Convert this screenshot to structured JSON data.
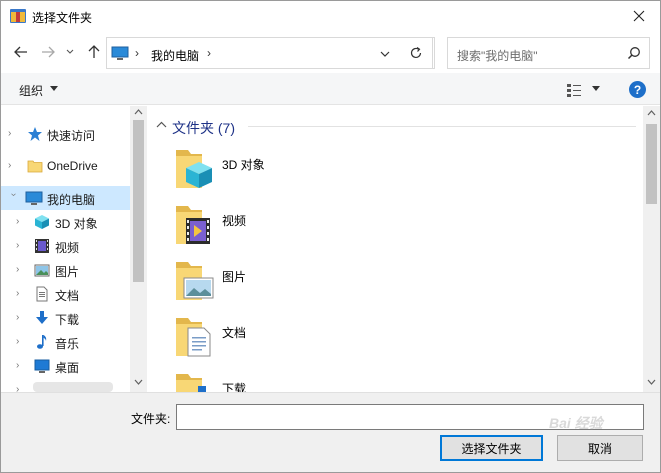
{
  "window": {
    "title": "选择文件夹"
  },
  "nav": {
    "address_text": "我的电脑",
    "search_placeholder": "搜索\"我的电脑\""
  },
  "toolbar": {
    "organize_label": "组织"
  },
  "sidebar": {
    "items": [
      {
        "label": "快速访问",
        "icon": "star-icon"
      },
      {
        "label": "OneDrive",
        "icon": "folder-icon"
      },
      {
        "label": "我的电脑",
        "icon": "computer-icon",
        "selected": true
      },
      {
        "label": "3D 对象",
        "icon": "cube-icon"
      },
      {
        "label": "视频",
        "icon": "film-icon"
      },
      {
        "label": "图片",
        "icon": "picture-icon"
      },
      {
        "label": "文档",
        "icon": "document-icon"
      },
      {
        "label": "下载",
        "icon": "download-icon"
      },
      {
        "label": "音乐",
        "icon": "music-icon"
      },
      {
        "label": "桌面",
        "icon": "desktop-icon"
      }
    ]
  },
  "main": {
    "group_title": "文件夹 (7)",
    "folders": [
      {
        "label": "3D 对象",
        "icon": "cube-folder-icon"
      },
      {
        "label": "视频",
        "icon": "film-folder-icon"
      },
      {
        "label": "图片",
        "icon": "picture-folder-icon"
      },
      {
        "label": "文档",
        "icon": "document-folder-icon"
      },
      {
        "label": "下载",
        "icon": "download-folder-icon"
      }
    ]
  },
  "bottom": {
    "field_label": "文件夹:",
    "folder_value": "",
    "select_button": "选择文件夹",
    "cancel_button": "取消"
  },
  "watermark": "Bai 经验",
  "colors": {
    "selected_bg": "#cde8ff",
    "group_title": "#1e3287",
    "accent": "#0078d7",
    "help": "#1e6fc9"
  }
}
